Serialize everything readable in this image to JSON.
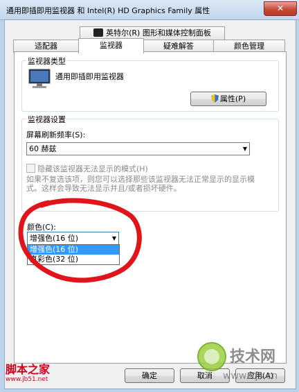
{
  "window": {
    "title": "通用即插即用监视器 和 Intel(R) HD Graphics Family 属性",
    "close_glyph": "✕"
  },
  "tabs_top": [
    {
      "label": "英特尔(R) 图形和媒体控制面板"
    }
  ],
  "tabs": [
    {
      "label": "适配器"
    },
    {
      "label": "监视器",
      "active": true
    },
    {
      "label": "疑难解答"
    },
    {
      "label": "颜色管理"
    }
  ],
  "monitor_type": {
    "group_label": "监视器类型",
    "monitor_name": "通用即插即用监视器",
    "properties_button": "属性(P)"
  },
  "monitor_settings": {
    "group_label": "监视器设置",
    "refresh_label": "屏幕刷新频率(S):",
    "refresh_value": "60 赫兹",
    "hide_modes_label": "隐藏该监视器无法显示的模式(H)",
    "hide_modes_checked": false,
    "warning": "如果不复选该项，则您可以选择那些该监视器无法正常显示的显示模式。这样会导致无法显示并且/或者损坏硬件。"
  },
  "colors": {
    "label": "颜色(C):",
    "selected": "增强色(16 位)",
    "options": [
      "增强色(16 位)",
      "真彩色(32 位)"
    ]
  },
  "buttons": {
    "ok": "确定",
    "cancel": "取消",
    "apply": "应用(A)"
  },
  "watermarks": {
    "left": "脚本之家",
    "left_url": "www.jb51.net",
    "right": "技术网",
    "right_url": "www.itjs.cn"
  },
  "annotation_color": "#e0151b"
}
